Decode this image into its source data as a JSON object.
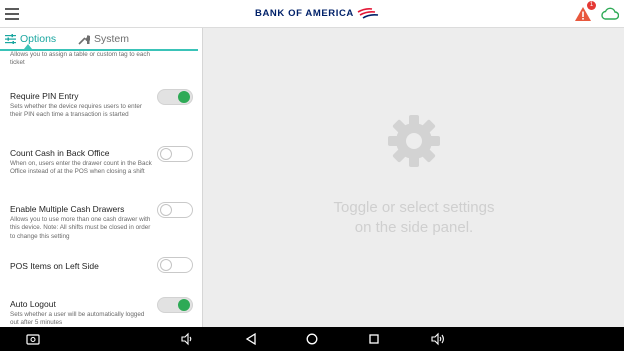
{
  "header": {
    "brand": "BANK OF AMERICA",
    "alert_count": "1",
    "icons": [
      "menu-icon",
      "warning-icon",
      "cloud-icon"
    ]
  },
  "tabs": [
    {
      "label": "Options",
      "active": true,
      "icon": "sliders-icon"
    },
    {
      "label": "System",
      "active": false,
      "icon": "wrench-icon"
    }
  ],
  "settings": [
    {
      "title": "",
      "desc": "Allows you to assign a table or custom tag to each ticket",
      "toggle": null
    },
    {
      "title": "Require PIN Entry",
      "desc": "Sets whether the device requires users to enter their PIN each time a transaction is started",
      "toggle": true
    },
    {
      "title": "Count Cash in Back Office",
      "desc": "When on, users enter the drawer count in the Back Office instead of at the POS when closing a shift",
      "toggle": false
    },
    {
      "title": "Enable Multiple Cash Drawers",
      "desc": "Allows you to use more than one cash drawer with this device. Note: All shifts must be closed in order to change this setting",
      "toggle": false
    },
    {
      "title": "POS Items on Left Side",
      "desc": "",
      "toggle": false
    },
    {
      "title": "Auto Logout",
      "desc": "Sets whether a user will be automatically logged out after 5 minutes",
      "toggle": true
    }
  ],
  "main": {
    "placeholder_line1": "Toggle or select settings",
    "placeholder_line2": "on the side panel."
  },
  "colors": {
    "accent": "#1aa6a0",
    "toggle_on": "#2eaa56",
    "brand_blue": "#012169",
    "brand_red": "#e31837"
  },
  "navbar": {
    "icons": [
      "screenshot-icon",
      "volume-down-icon",
      "back-icon",
      "home-icon",
      "recents-icon",
      "volume-up-icon"
    ]
  }
}
